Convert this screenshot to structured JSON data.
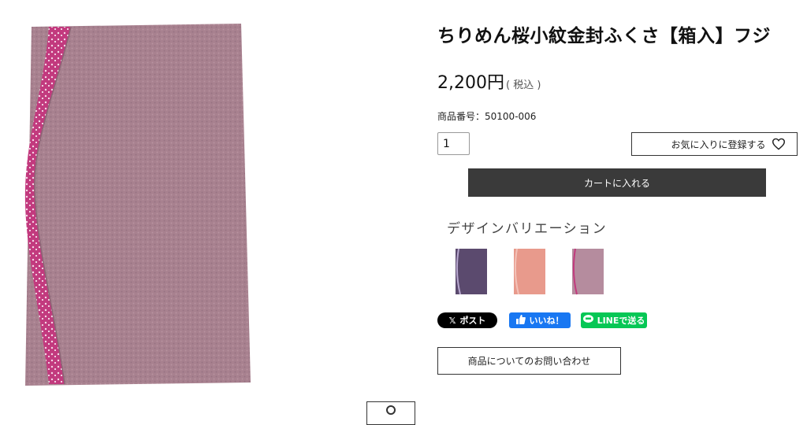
{
  "product": {
    "title": "ちりめん桜小紋金封ふくさ【箱入】フジ",
    "price": "2,200円",
    "tax_label": "( 税込 )",
    "sku_label": "商品番号：",
    "sku_value": "50100-006",
    "quantity": "1",
    "image_name": "fukusa-fuji-product-photo"
  },
  "actions": {
    "favorite_label": "お気に入りに登録する",
    "cart_label": "カートに入れる",
    "inquiry_label": "商品についてのお問い合わせ"
  },
  "variations": {
    "title": "デザインバリエーション",
    "items": [
      {
        "name": "purple",
        "color": "#5b4a6e"
      },
      {
        "name": "salmon",
        "color": "#e89a8c"
      },
      {
        "name": "fuji",
        "color": "#b58c9e"
      }
    ]
  },
  "share": {
    "x_label": "ポスト",
    "fb_label": "いいね！",
    "line_label": "LINEで送る"
  },
  "colors": {
    "cloth": "#a8818f",
    "accent": "#c23a7e",
    "cart_bg": "#3a3a3a",
    "fb": "#1877f2",
    "line": "#06c755"
  }
}
